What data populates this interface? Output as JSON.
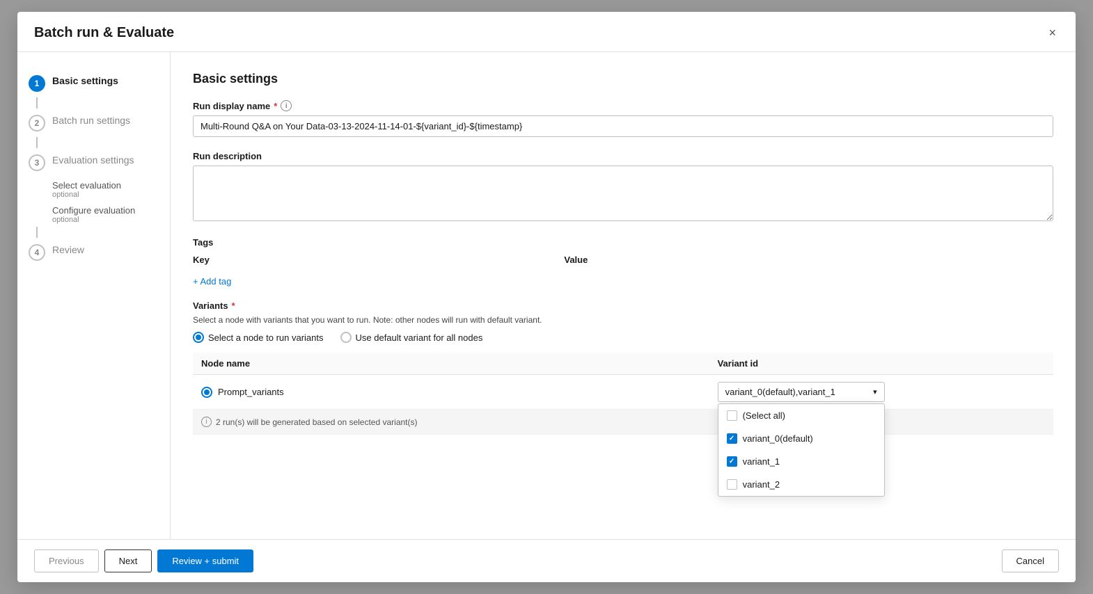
{
  "modal": {
    "title": "Batch run & Evaluate",
    "close_label": "×"
  },
  "sidebar": {
    "steps": [
      {
        "id": "basic-settings",
        "number": "1",
        "label": "Basic settings",
        "active": true
      },
      {
        "id": "batch-run-settings",
        "number": "2",
        "label": "Batch run settings",
        "active": false
      },
      {
        "id": "evaluation-settings",
        "number": "3",
        "label": "Evaluation settings",
        "active": false
      }
    ],
    "sub_steps": [
      {
        "id": "select-evaluation",
        "label": "Select evaluation",
        "optional": "optional"
      },
      {
        "id": "configure-evaluation",
        "label": "Configure evaluation",
        "optional": "optional"
      }
    ],
    "review_step": {
      "number": "4",
      "label": "Review"
    }
  },
  "main": {
    "section_title": "Basic settings",
    "run_display_name": {
      "label": "Run display name",
      "required": true,
      "value": "Multi-Round Q&A on Your Data-03-13-2024-11-14-01-${variant_id}-${timestamp}",
      "placeholder": ""
    },
    "run_description": {
      "label": "Run description",
      "required": false,
      "value": "",
      "placeholder": ""
    },
    "tags": {
      "label": "Tags",
      "columns": [
        "Key",
        "Value"
      ],
      "add_tag_label": "+ Add tag"
    },
    "variants": {
      "label": "Variants",
      "required": true,
      "description": "Select a node with variants that you want to run. Note: other nodes will run with default variant.",
      "radio_options": [
        {
          "id": "select-node",
          "label": "Select a node to run variants",
          "selected": true
        },
        {
          "id": "use-default",
          "label": "Use default variant for all nodes",
          "selected": false
        }
      ],
      "table_columns": [
        "Node name",
        "Variant id"
      ],
      "table_rows": [
        {
          "node_name": "Prompt_variants",
          "variant_id_display": "variant_0(default),variant_1",
          "selected": true
        }
      ],
      "info_row": "2 run(s) will be generated based on selected variant(s)",
      "dropdown": {
        "selected_display": "variant_0(default),variant_1",
        "options": [
          {
            "id": "select-all",
            "label": "(Select all)",
            "checked": false
          },
          {
            "id": "variant-0",
            "label": "variant_0(default)",
            "checked": true
          },
          {
            "id": "variant-1",
            "label": "variant_1",
            "checked": true
          },
          {
            "id": "variant-2",
            "label": "variant_2",
            "checked": false
          }
        ]
      }
    }
  },
  "footer": {
    "previous_label": "Previous",
    "next_label": "Next",
    "review_submit_label": "Review + submit",
    "cancel_label": "Cancel"
  }
}
